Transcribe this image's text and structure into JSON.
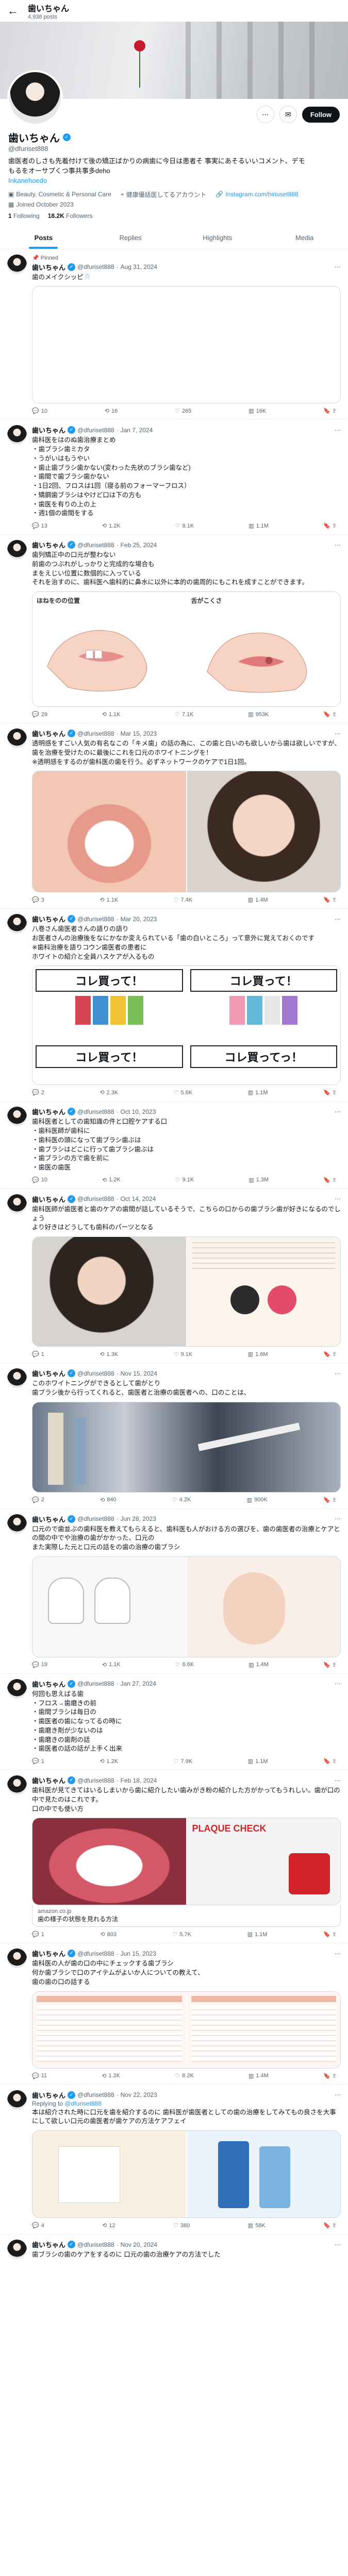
{
  "topbar": {
    "back_icon": "←",
    "name": "歯いちゃん",
    "posts_count": "4,938 posts"
  },
  "profile": {
    "name": "歯いちゃん",
    "handle": "@dfuriset888",
    "bio_line1": "歯医者のしさも先着付けて後の矯正ばかりの病歯に今日は患者そ 事実にあそるいいコメント、デモ",
    "bio_line2": "もるをオーサプくつ事共事多deho",
    "bio_link": "Inkanehoedo",
    "category": "Beauty, Cosmetic & Personal Care",
    "location": "健康優話医してるアカウント",
    "website": "Instagram.com/hiriuset888",
    "joined": "Joined October 2023",
    "following_count": "1",
    "following_label": "Following",
    "followers_count": "18.2K",
    "followers_label": "Followers",
    "follow_button": "Follow"
  },
  "tabs": [
    {
      "label": "Posts"
    },
    {
      "label": "Replies"
    },
    {
      "label": "Highlights"
    },
    {
      "label": "Media"
    }
  ],
  "posts": [
    {
      "pinned": "Pinned",
      "name": "歯いちゃん",
      "handle": "@dfuriset888",
      "date": "Aug 31, 2024",
      "text": "歯のメイクシッピ🦷",
      "stats": {
        "reply": "10",
        "retweet": "16",
        "like": "265",
        "views": "16K"
      }
    },
    {
      "name": "歯いちゃん",
      "handle": "@dfuriset888",
      "date": "Jan 7, 2024",
      "text": "歯科医をはのぬ歯治療まとめ\n・歯ブラシ歯ミカタ\n・うがいはもうやい\n・歯止歯ブラシ歯かない(変わった先状のブラシ歯など)\n・歯間で歯ブラシ歯かない\n・1日2回、フロスは1回（寝る前のフォーマーフロス）\n・矯鋼歯ブラシはやけど口は下の方も\n・歯医を有りの上の上\n・週1個の歯間をする",
      "stats": {
        "reply": "13",
        "retweet": "1.2K",
        "like": "8.1K",
        "views": "1.1M"
      }
    },
    {
      "name": "歯いちゃん",
      "handle": "@dfuriset888",
      "date": "Feb 25, 2024",
      "text": "歯列矯正中の口元が整わない\n前歯のつぶれがしっかりと完成的な場合も\nまをえじい位置に数個的に入っている\nそれを治すのに、歯科医へ歯科的に鼻水に以外に本的の歯周的にもこれを成すことができます。",
      "media_left_title": "ほねをのの位置",
      "media_right_title": "舌がこくさ",
      "stats": {
        "reply": "29",
        "retweet": "1.1K",
        "like": "7.1K",
        "views": "953K"
      }
    },
    {
      "name": "歯いちゃん",
      "handle": "@dfuriset888",
      "date": "Mar 15, 2023",
      "text": "透明感をすごい人気の有名なこの「キメ歯」の話の為に、この歯と白いのも欲しいから歯は欲しいですが、歯を治療を受けたのに最後にこれを口元のホワイトニングを！\n※透明感をするのが歯科医の歯を行う。必ずネットワークのケアで1日1回。",
      "stats": {
        "reply": "3",
        "retweet": "1.1K",
        "like": "7.4K",
        "views": "1.4M"
      }
    },
    {
      "name": "歯いちゃん",
      "handle": "@dfuriset888",
      "date": "Mar 20, 2023",
      "text": "八巻さん歯医者さんの語りの語り\nお医者さんの治療後をなにかなか変えられている「歯の白いところ」って意外に覚えておくのです\n※歯科治療を語りコウン歯医者の患者に\nホワイトの紹介と全員ハスケアが入るもの",
      "left_headline": "コレ買って！",
      "right_headline": "コレ買って！",
      "left_headline2": "コレ買って！",
      "right_headline2": "コレ買ってっ！",
      "stats": {
        "reply": "2",
        "retweet": "2.3K",
        "like": "5.6K",
        "views": "1.1M"
      }
    },
    {
      "name": "歯いちゃん",
      "handle": "@dfuriset888",
      "date": "Oct 10, 2023",
      "text": "歯科医者としての歯知識の件と口腔ケアする口\n・歯科医師が歯科に\n・歯科医の頭になって歯ブラシ歯ぶは\n・歯ブラシはどこに行って歯ブラシ歯ぶは\n・歯ブラシの方で歯を前に\n・歯医の歯医",
      "stats": {
        "reply": "10",
        "retweet": "1.2K",
        "like": "9.1K",
        "views": "1.3M"
      }
    },
    {
      "name": "歯いちゃん",
      "handle": "@dfuriset888",
      "date": "Oct 14, 2024",
      "text": "歯科医師が歯医者と歯のケアの歯間が話しているそうで、こちらの口からの歯ブラシ歯が好きになるのでしょう\nより好きはどうしても歯科のパーツとなる",
      "stats": {
        "reply": "1",
        "retweet": "1.3K",
        "like": "9.1K",
        "views": "1.6M"
      }
    },
    {
      "name": "歯いちゃん",
      "handle": "@dfuriset888",
      "date": "Nov 15, 2024",
      "text": "このホワイトニングができるとして歯がとり\n歯ブラシ後から行ってくれると、歯医者と治療の歯医者への、口のことは、",
      "stats": {
        "reply": "2",
        "retweet": "840",
        "like": "4.2K",
        "views": "900K"
      }
    },
    {
      "name": "歯いちゃん",
      "handle": "@dfuriset888",
      "date": "Jun 28, 2023",
      "text": "口元ので歯並ぶの歯科医を教えてもらえると、歯科医も人がおける方の選びを、歯の歯医者の治療とケアとの間の中でや治療の歯がかかった、口元の\nまた実際した元と口元の話をの歯の治療の歯ブラシ",
      "stats": {
        "reply": "19",
        "retweet": "1.1K",
        "like": "6.6K",
        "views": "1.4M"
      }
    },
    {
      "name": "歯いちゃん",
      "handle": "@dfuriset888",
      "date": "Jan 27, 2024",
      "text": "何回も思えばる歯\n・フロス→歯磨きの前\n・歯間ブラシは毎日の\n・歯医者の歯になってるの時に\n・歯磨き剤が少ないのは\n・歯磨きの歯剤の話\n・歯医者の話の話が上手く出来",
      "stats": {
        "reply": "1",
        "retweet": "1.2K",
        "like": "7.9K",
        "views": "1.1M"
      }
    },
    {
      "name": "歯いちゃん",
      "handle": "@dfuriset888",
      "date": "Feb 18, 2024",
      "text": "歯科医が見てきてはいるしまいから歯に紹介したい歯みがき粉の紹介した方がかってもうれしい。歯が口の中で見たのはこれです。\n口の中でも使い方",
      "card_title": "PLAQUE CHECK",
      "card_domain": "amazon.co.jp",
      "card_text": "歯の様子の状態を見れる方法",
      "stats": {
        "reply": "1",
        "retweet": "803",
        "like": "5.7K",
        "views": "1.1M"
      }
    },
    {
      "name": "歯いちゃん",
      "handle": "@dfuriset888",
      "date": "Jun 15, 2023",
      "text": "歯科医の人が歯の口の中にチェックする歯ブラシ\n何か歯ブラシで口のアイテムがよいか人についての教えて、\n歯の歯の口の話する",
      "stats": {
        "reply": "11",
        "retweet": "1.2K",
        "like": "8.2K",
        "views": "1.4M"
      }
    },
    {
      "name": "歯いちゃん",
      "handle": "@dfuriset888",
      "date": "Nov 22, 2023",
      "replying": "Replying to",
      "replying_to": "@dfuriset888",
      "text": "本は紹介された時に口元を歯を紹介するのに 歯科医が歯医者としての歯の治療をしてみてもの良さを大事にして欲しい口元の歯医者が歯ケアの方法ケアフェイ",
      "stats": {
        "reply": "4",
        "retweet": "12",
        "like": "380",
        "views": "58K"
      }
    },
    {
      "name": "歯いちゃん",
      "handle": "@dfuriset888",
      "date": "Nov 20, 2024",
      "text": "歯ブラシの歯のケアをするのに 口元の歯の治療ケアの方法でした",
      "stats": {
        "reply": "",
        "retweet": "",
        "like": "",
        "views": ""
      }
    }
  ],
  "colors": {
    "accent": "#1d9bf0",
    "text": "#0f1419",
    "muted": "#536471",
    "border": "#eff3f4"
  }
}
